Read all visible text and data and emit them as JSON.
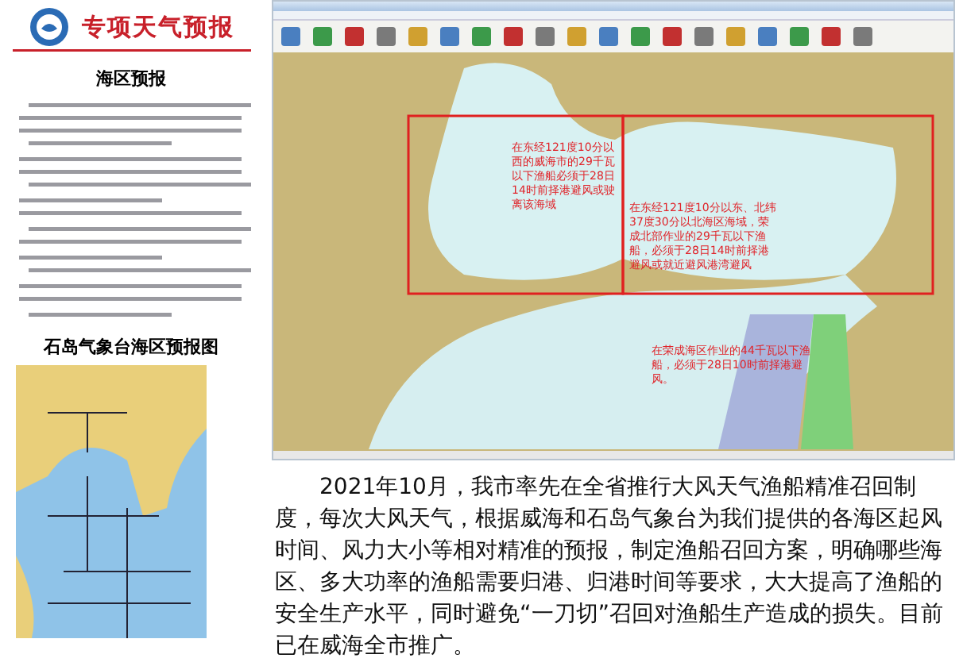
{
  "document": {
    "title": "专项天气预报",
    "heading": "海区预报"
  },
  "zone_map": {
    "title": "石岛气象台海区预报图"
  },
  "app": {
    "annotations": [
      {
        "text": "在东经121度10分以西的威海市的29千瓦以下渔船必须于28日14时前择港避风或驶离该海域"
      },
      {
        "text": "在东经121度10分以东、北纬37度30分以北海区海域，荣成北部作业的29千瓦以下渔船，必须于28日14时前择港避风或就近避风港湾避风"
      },
      {
        "text": "在荣成海区作业的44千瓦以下渔船，必须于28日10时前择港避风。"
      }
    ]
  },
  "article": {
    "text": "2021年10月，我市率先在全省推行大风天气渔船精准召回制度，每次大风天气，根据威海和石岛气象台为我们提供的各海区起风时间、风力大小等相对精准的预报，制定渔船召回方案，明确哪些海区、多大功率的渔船需要归港、归港时间等要求，大大提高了渔船的安全生产水平，同时避免“一刀切”召回对渔船生产造成的损失。目前已在威海全市推广。"
  }
}
